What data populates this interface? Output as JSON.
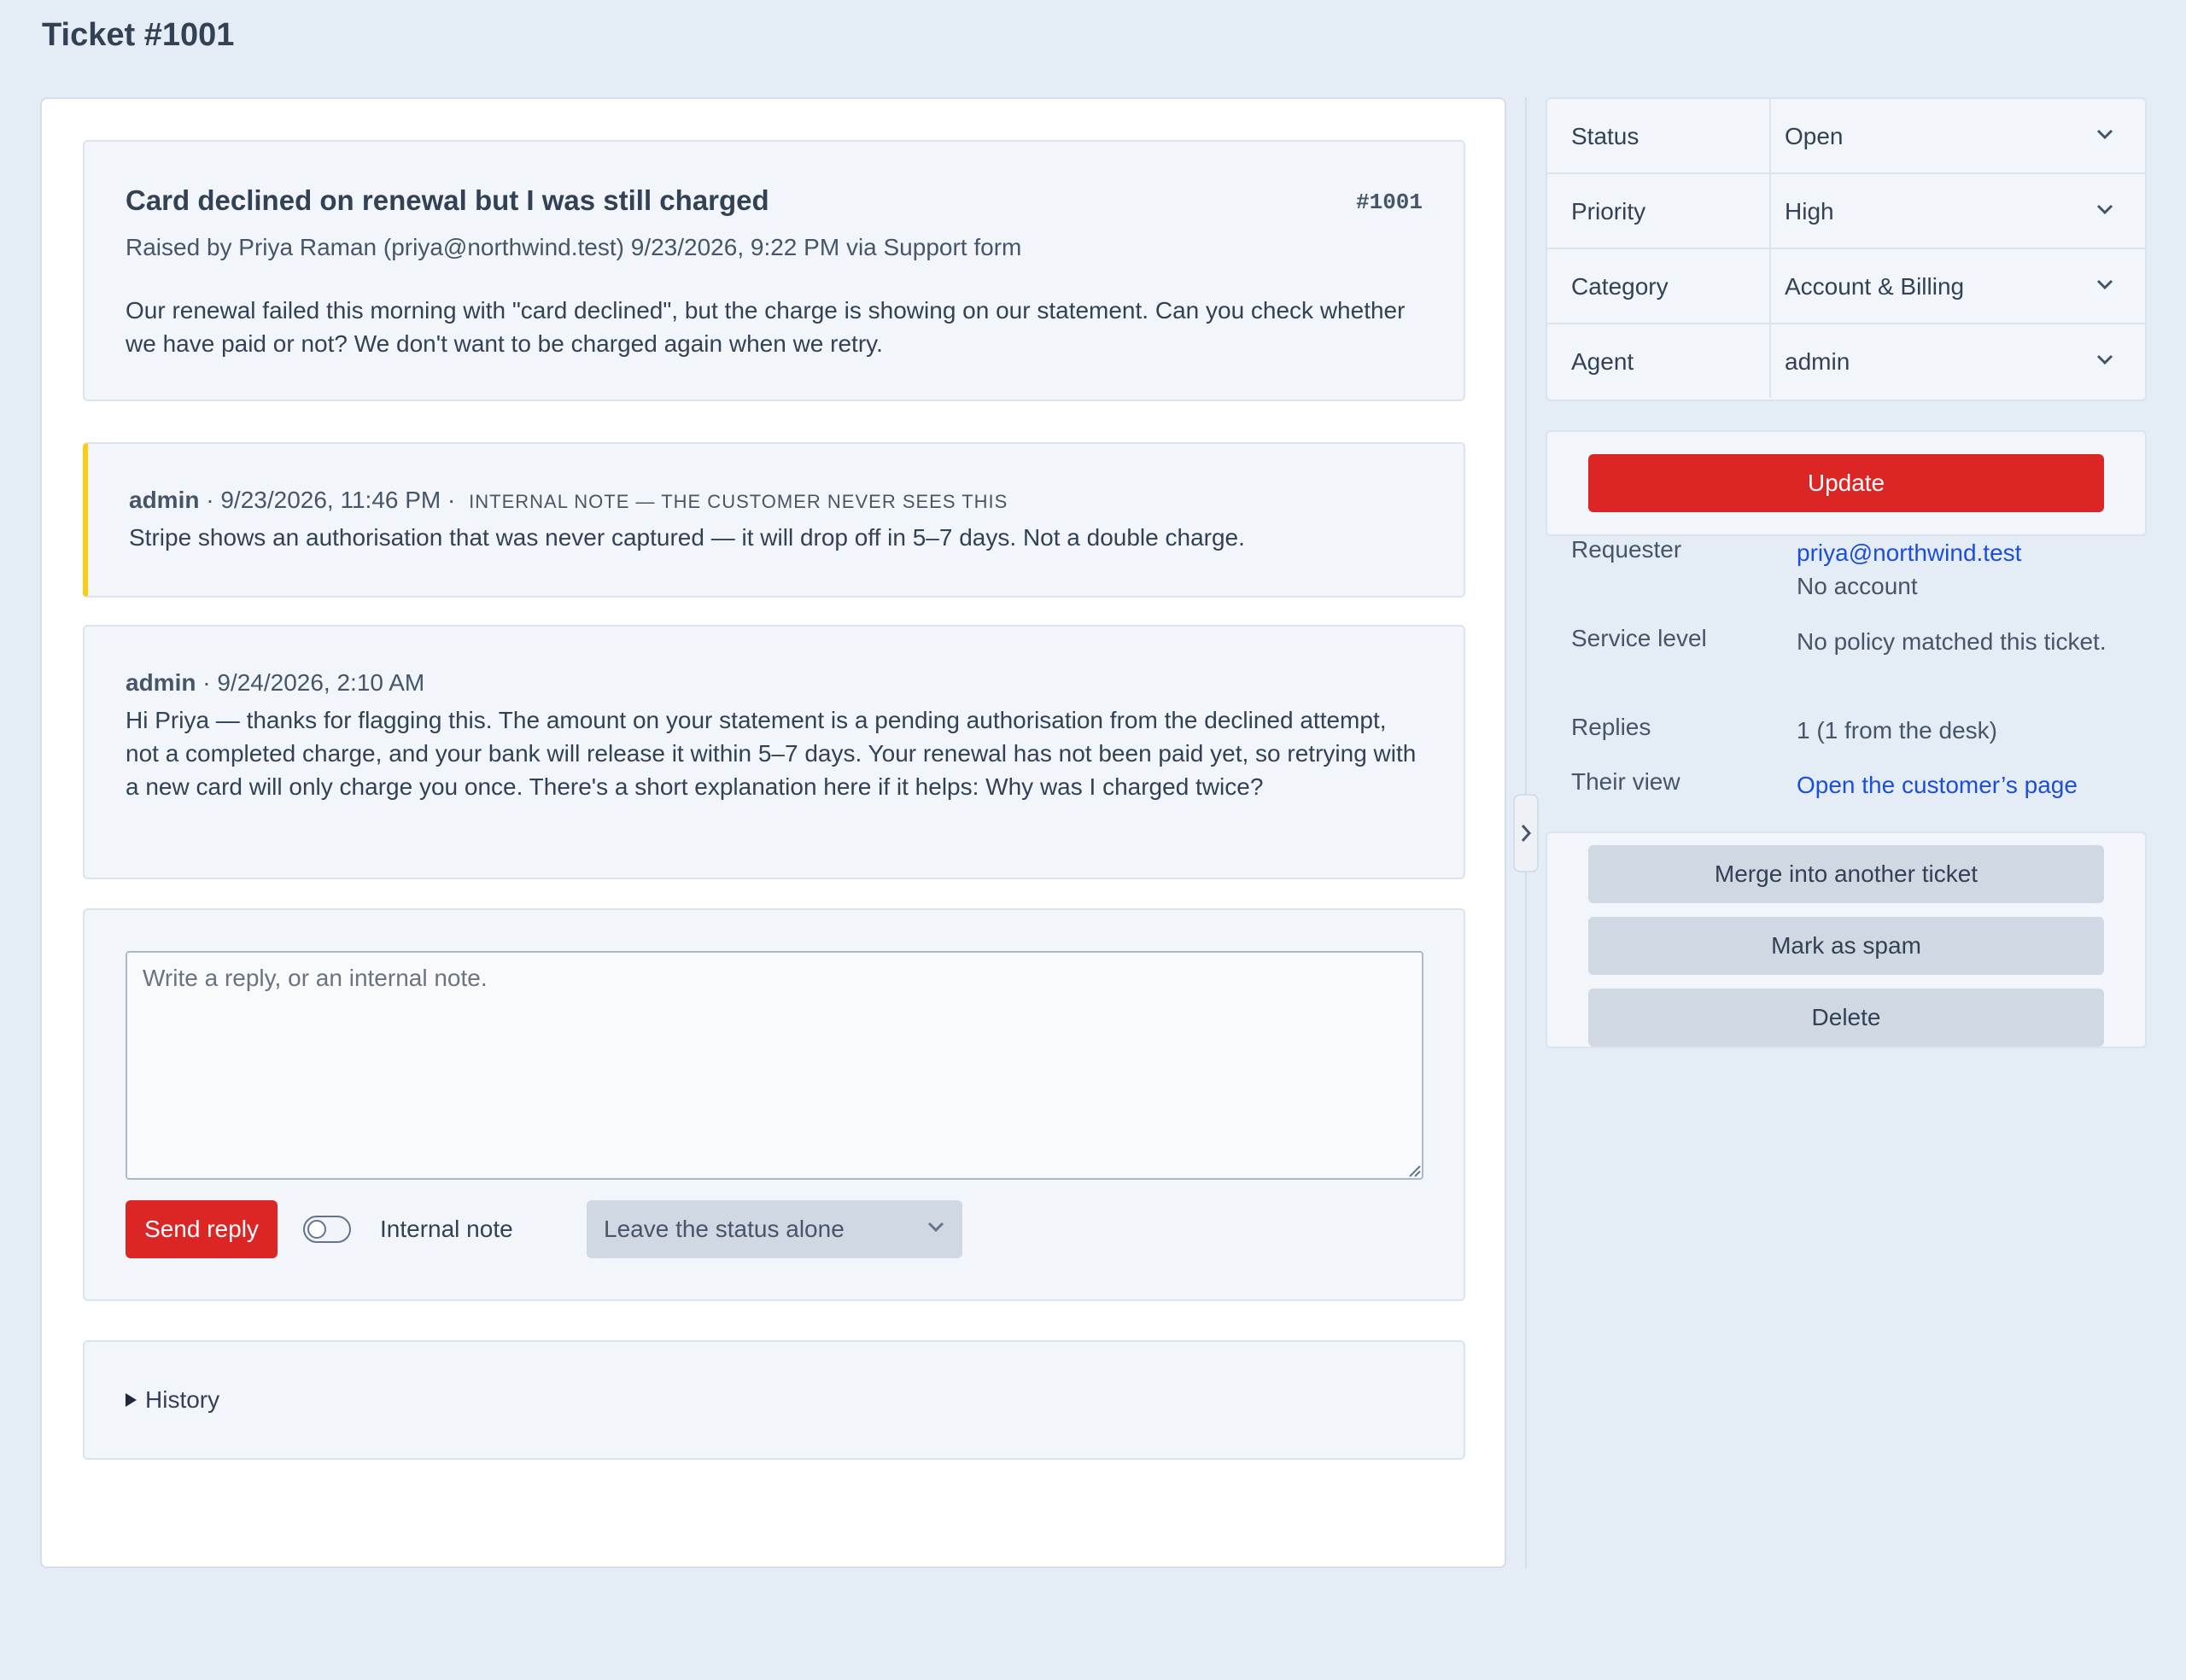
{
  "page": {
    "title": "Ticket #1001"
  },
  "ticket": {
    "subject": "Card declined on renewal but I was still charged",
    "number": "#1001",
    "meta": "Raised by Priya Raman (priya@northwind.test) 9/23/2026, 9:22 PM via Support form",
    "body": "Our renewal failed this morning with \"card declined\", but the charge is showing on our statement. Can you check whether we have paid or not? We don't want to be charged again when we retry."
  },
  "internal_note": {
    "author": "admin",
    "time": "9/23/2026, 11:46 PM",
    "separator": " · ",
    "tag": "Internal note — the customer never sees this",
    "body": "Stripe shows an authorisation that was never captured — it will drop off in 5–7 days. Not a double charge.",
    "accent_color": "#facc15"
  },
  "reply": {
    "author": "admin",
    "time": "9/24/2026, 2:10 AM",
    "separator": " · ",
    "body": "Hi Priya — thanks for flagging this. The amount on your statement is a pending authorisation from the declined attempt, not a completed charge, and your bank will release it within 5–7 days. Your renewal has not been paid yet, so retrying with a new card will only charge you once. There's a short explanation here if it helps: Why was I charged twice?"
  },
  "composer": {
    "placeholder": "Write a reply, or an internal note.",
    "value": "",
    "send_label": "Send reply",
    "internal_note_label": "Internal note",
    "internal_note_on": false,
    "status_select": "Leave the status alone"
  },
  "history": {
    "label": "History"
  },
  "fields": {
    "status": {
      "label": "Status",
      "value": "Open"
    },
    "priority": {
      "label": "Priority",
      "value": "High"
    },
    "category": {
      "label": "Category",
      "value": "Account & Billing"
    },
    "agent": {
      "label": "Agent",
      "value": "admin"
    }
  },
  "update_label": "Update",
  "details": {
    "requester_label": "Requester",
    "requester_email": "priya@northwind.test",
    "requester_account": "No account",
    "service_level_label": "Service level",
    "service_level_value": "No policy matched this ticket.",
    "replies_label": "Replies",
    "replies_value": "1 (1 from the desk)",
    "their_view_label": "Their view",
    "their_view_link": "Open the customer’s page"
  },
  "actions": {
    "merge": "Merge into another ticket",
    "spam": "Mark as spam",
    "delete": "Delete"
  },
  "icons": {
    "chevron": "chevron-down-icon",
    "collapse": "chevron-right-icon",
    "history_toggle": "triangle-right-icon"
  },
  "colors": {
    "accent": "#dc2626",
    "link": "#1d4ed8",
    "background": "#e4ecf5"
  }
}
